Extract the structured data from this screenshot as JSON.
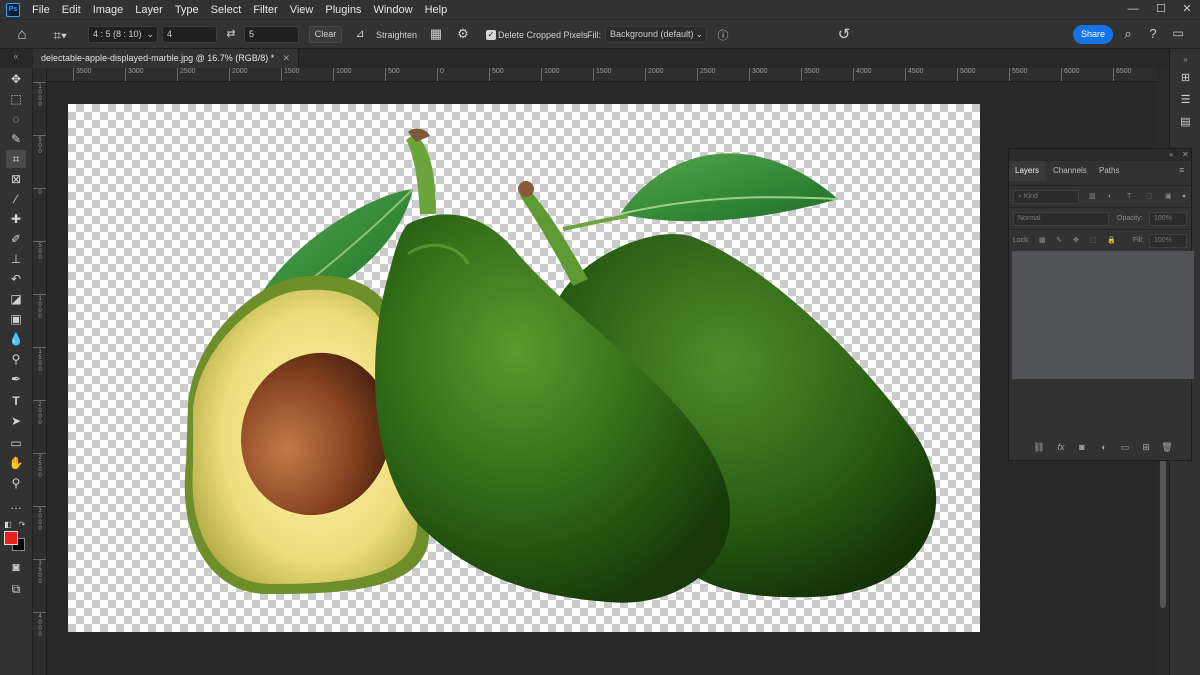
{
  "menubar": {
    "logo": "Ps",
    "items": [
      "File",
      "Edit",
      "Image",
      "Layer",
      "Type",
      "Select",
      "Filter",
      "View",
      "Plugins",
      "Window",
      "Help"
    ],
    "controls": [
      "—",
      "☐",
      "✕"
    ]
  },
  "options": {
    "ratio_value": "4 : 5 (8 : 10)",
    "width_value": "4",
    "height_value": "5",
    "clear_label": "Clear",
    "straighten_label": "Straighten",
    "delete_cropped_label": "Delete Cropped Pixels",
    "delete_cropped_checked": true,
    "fill_label": "Fill:",
    "fill_value": "Background (default)",
    "share_label": "Share"
  },
  "document": {
    "tab_title": "delectable-apple-displayed-marble.jpg @ 16.7% (RGB/8) *",
    "close_glyph": "✕"
  },
  "ruler": {
    "h_labels": [
      "3500",
      "3000",
      "2500",
      "2000",
      "1500",
      "1000",
      "500",
      "0",
      "500",
      "1000",
      "1500",
      "2000",
      "2500",
      "3000",
      "3500",
      "4000",
      "4500",
      "5000",
      "5500",
      "6000",
      "6500"
    ],
    "v_labels": [
      "1000",
      "500",
      "0",
      "500",
      "1000",
      "1500",
      "2000",
      "2500",
      "3000",
      "3500",
      "4000"
    ]
  },
  "layers_panel": {
    "tabs": [
      "Layers",
      "Channels",
      "Paths"
    ],
    "kind_label": "Kind",
    "blend_mode": "Normal",
    "opacity_label": "Opacity:",
    "opacity_value": "100%",
    "lock_label": "Lock:",
    "fill_label": "Fill:",
    "fill_value": "100%"
  },
  "colors": {
    "foreground": "#e5211d",
    "background": "#000000",
    "accent": "#1473e6"
  }
}
